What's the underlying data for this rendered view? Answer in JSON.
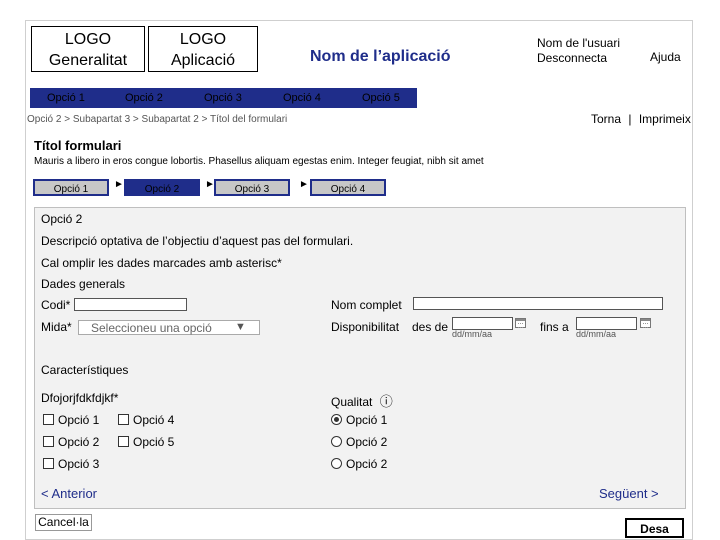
{
  "header": {
    "logo_generalitat": [
      "LOGO",
      "Generalitat"
    ],
    "logo_aplicacio": [
      "LOGO",
      "Aplicació"
    ],
    "app_name": "Nom de l’aplicació",
    "user_name": "Nom de l'usuari",
    "logout": "Desconnecta",
    "help": "Ajuda"
  },
  "menu": {
    "items": [
      {
        "label": "Opció 1"
      },
      {
        "label": "Opció 2"
      },
      {
        "label": "Opció 3"
      },
      {
        "label": "Opció 4"
      },
      {
        "label": "Opció 5"
      }
    ]
  },
  "breadcrumb": "Opció 2 > Subapartat 3 > Subapartat 2 > Títol del formulari",
  "actions": {
    "back": "Torna",
    "separator": "|",
    "print": "Imprimeix"
  },
  "form": {
    "title": "Títol formulari",
    "intro": "Mauris a libero in eros congue lobortis. Phasellus aliquam egestas enim. Integer feugiat, nibh sit amet",
    "steps": [
      {
        "label": "Opció 1",
        "active": false
      },
      {
        "label": "Opció 2",
        "active": true
      },
      {
        "label": "Opció 3",
        "active": false
      },
      {
        "label": "Opció 4",
        "active": false
      }
    ],
    "step_arrow": "►",
    "panel": {
      "title": "Opció 2",
      "description": "Descripció optativa de l’objectiu d’aquest pas del formulari.",
      "required_note": "Cal omplir les dades marcades amb asterisc*",
      "general_section": "Dades generals",
      "codi_label": "Codi*",
      "codi_value": "",
      "nom_label": "Nom complet",
      "nom_value": "",
      "mida_label": "Mida*",
      "mida_select": "Seleccioneu una opció",
      "select_arrow": "▼",
      "disponibilitat_label": "Disponibilitat",
      "des_de": "des de",
      "fins_a": "fins a",
      "date_placeholder": "dd/mm/aa",
      "features_section": "Característiques",
      "dfo_label": "Dfojorjfdkfdjkf*",
      "qualitat_label": "Qualitat",
      "info_icon": "ⓘ",
      "checkboxes_col1": [
        "Opció 1",
        "Opció 2",
        "Opció 3"
      ],
      "checkboxes_col2": [
        "Opció 4",
        "Opció 5"
      ],
      "radios": [
        {
          "label": "Opció 1",
          "checked": true
        },
        {
          "label": "Opció 2",
          "checked": false
        },
        {
          "label": "Opció 2",
          "checked": false
        }
      ],
      "prev": "< Anterior",
      "next": "Següent >"
    },
    "cancel": "Cancel·la",
    "save": "Desa"
  }
}
